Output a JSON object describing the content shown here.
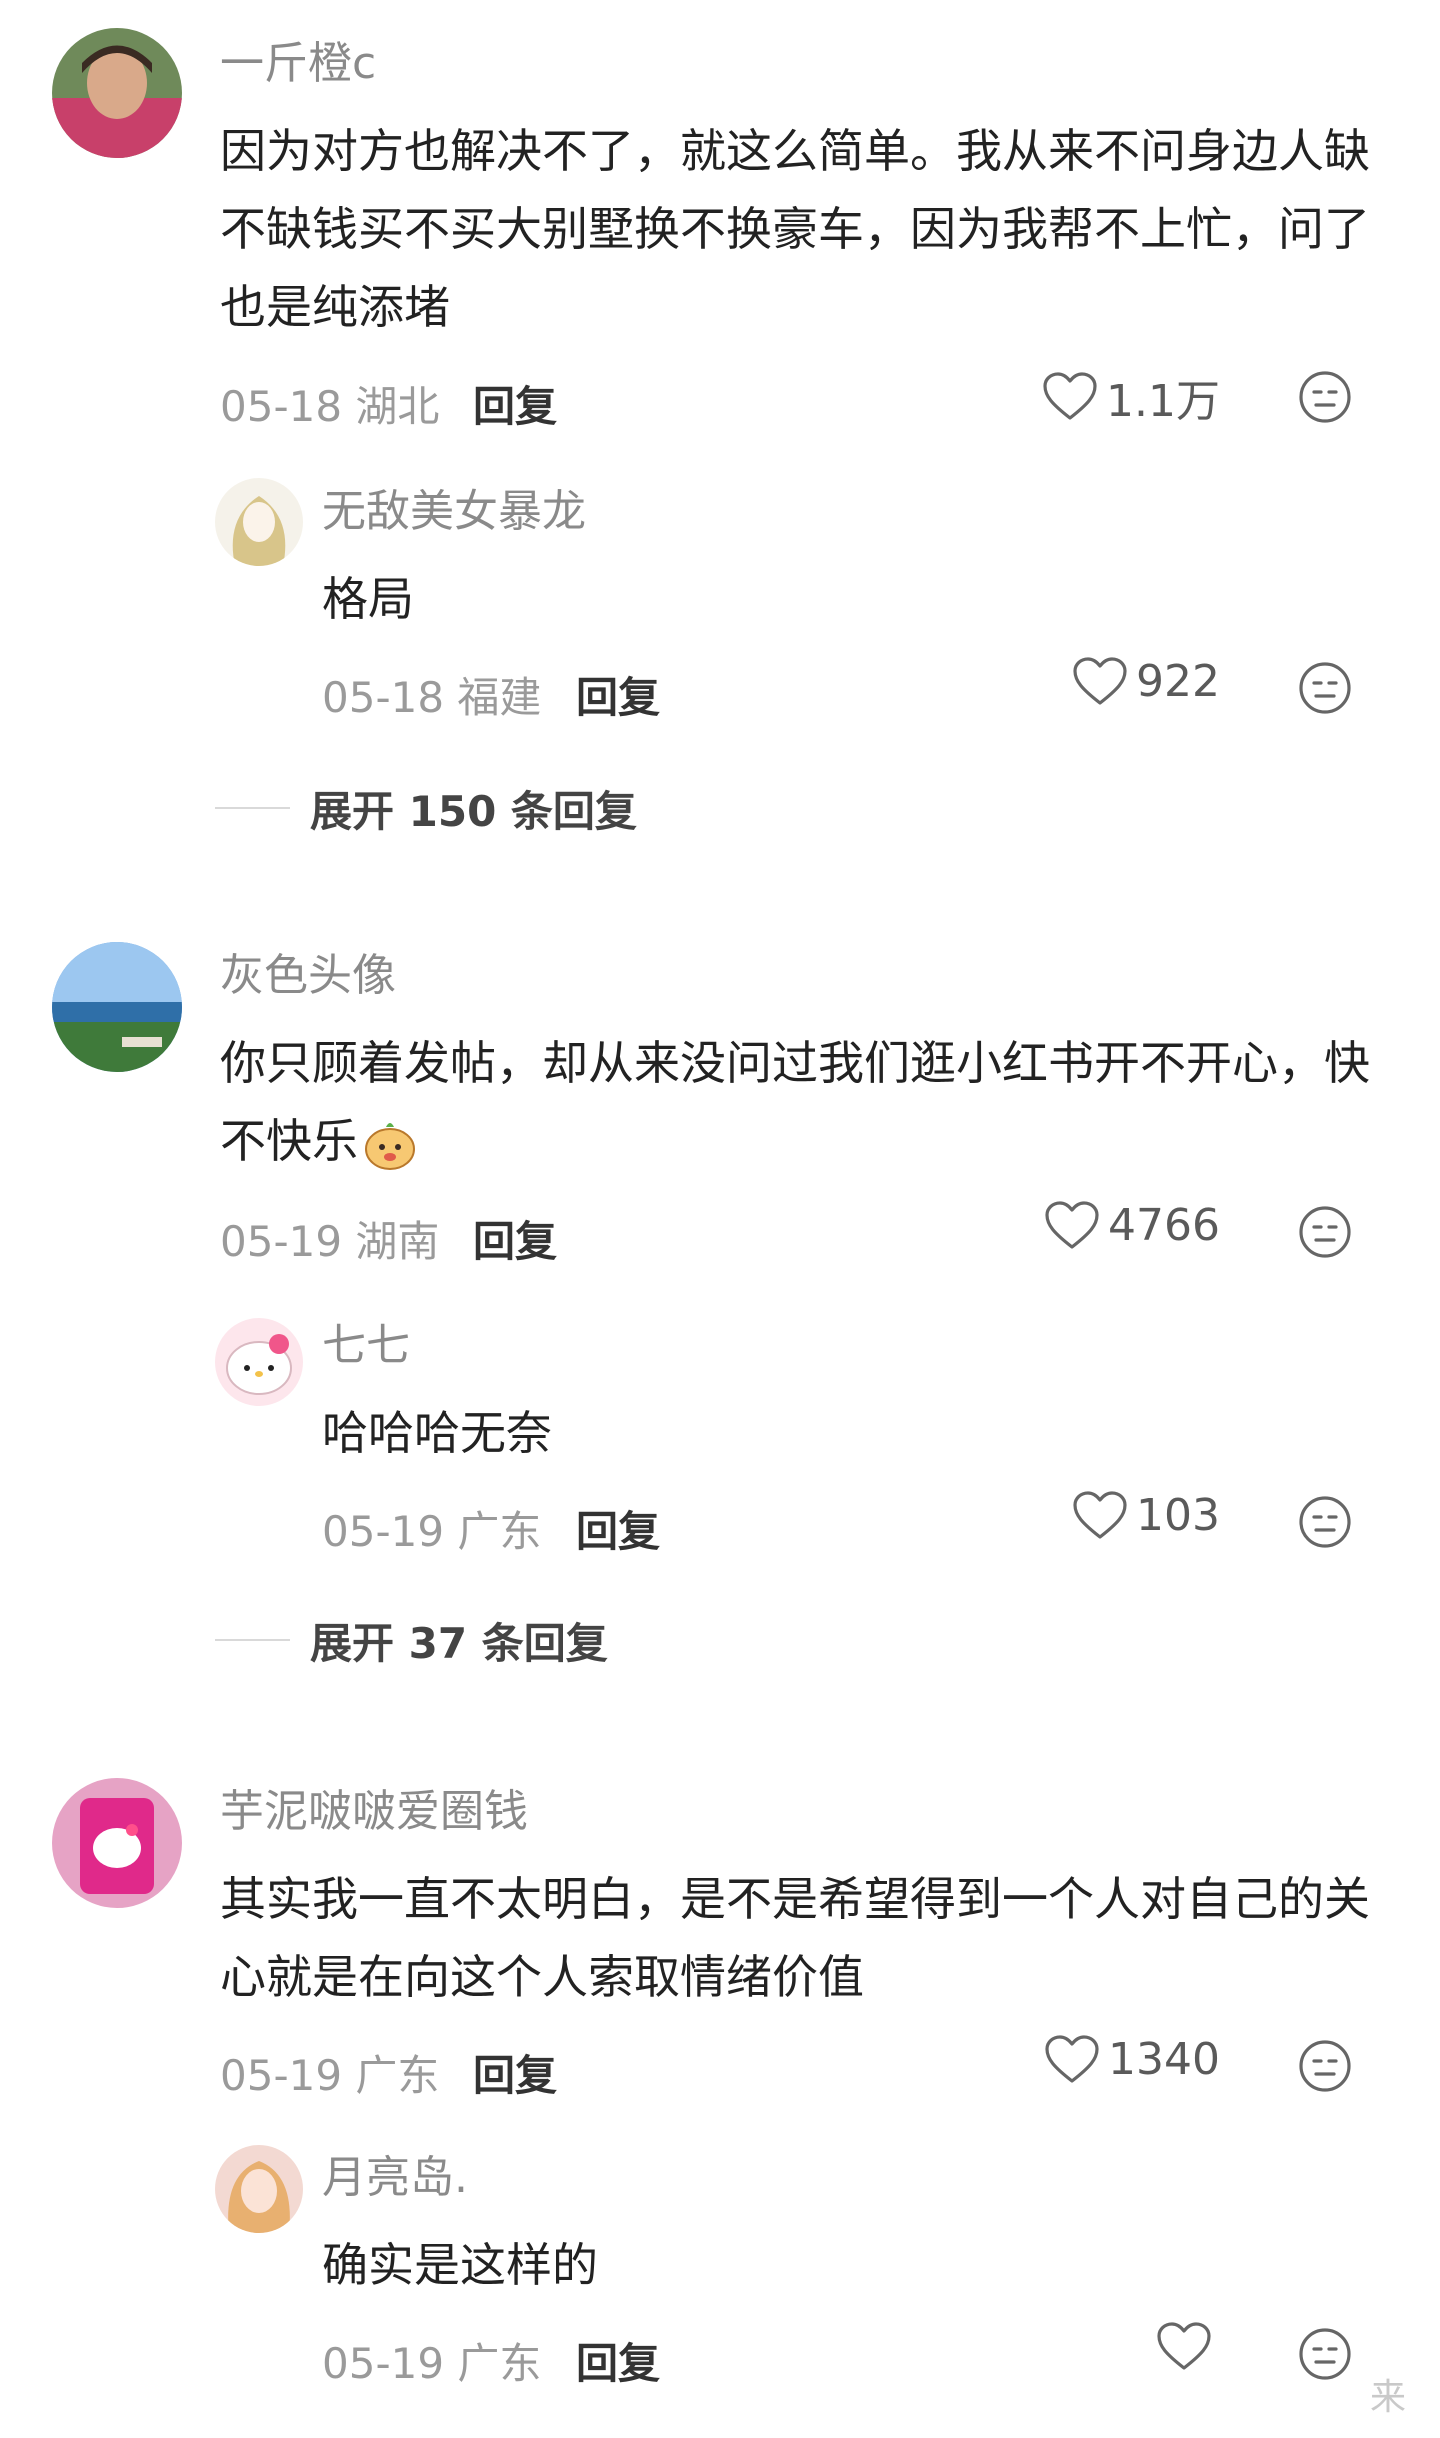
{
  "comments": [
    {
      "username": "一斤橙c",
      "text": "因为对方也解决不了，就这么简单。我从来不问身边人缺不缺钱买不买大别墅换不换豪车，因为我帮不上忙，问了也是纯添堵",
      "date": "05-18",
      "location": "湖北",
      "reply_label": "回复",
      "likes": "1.1万",
      "reply": {
        "username": "无敌美女暴龙",
        "text": "格局",
        "date": "05-18",
        "location": "福建",
        "reply_label": "回复",
        "likes": "922"
      },
      "expand_label": "展开 150 条回复"
    },
    {
      "username": "灰色头像",
      "text": "你只顾着发帖，却从来没问过我们逛小红书开不开心，快不快乐",
      "date": "05-19",
      "location": "湖南",
      "reply_label": "回复",
      "likes": "4766",
      "reply": {
        "username": "七七",
        "text": "哈哈哈无奈",
        "date": "05-19",
        "location": "广东",
        "reply_label": "回复",
        "likes": "103"
      },
      "expand_label": "展开 37 条回复"
    },
    {
      "username": "芋泥啵啵爱圈钱",
      "text": "其实我一直不太明白，是不是希望得到一个人对自己的关心就是在向这个人索取情绪价值",
      "date": "05-19",
      "location": "广东",
      "reply_label": "回复",
      "likes": "1340",
      "reply": {
        "username": "月亮岛.",
        "text": "确实是这样的",
        "date": "05-19",
        "location": "广东",
        "reply_label": "回复",
        "likes": ""
      }
    }
  ],
  "icons": {
    "like": "heart-outline-icon",
    "dislike": "neutral-face-icon",
    "inline_emoji": "cute-mascot-emoji"
  },
  "watermark": "来"
}
